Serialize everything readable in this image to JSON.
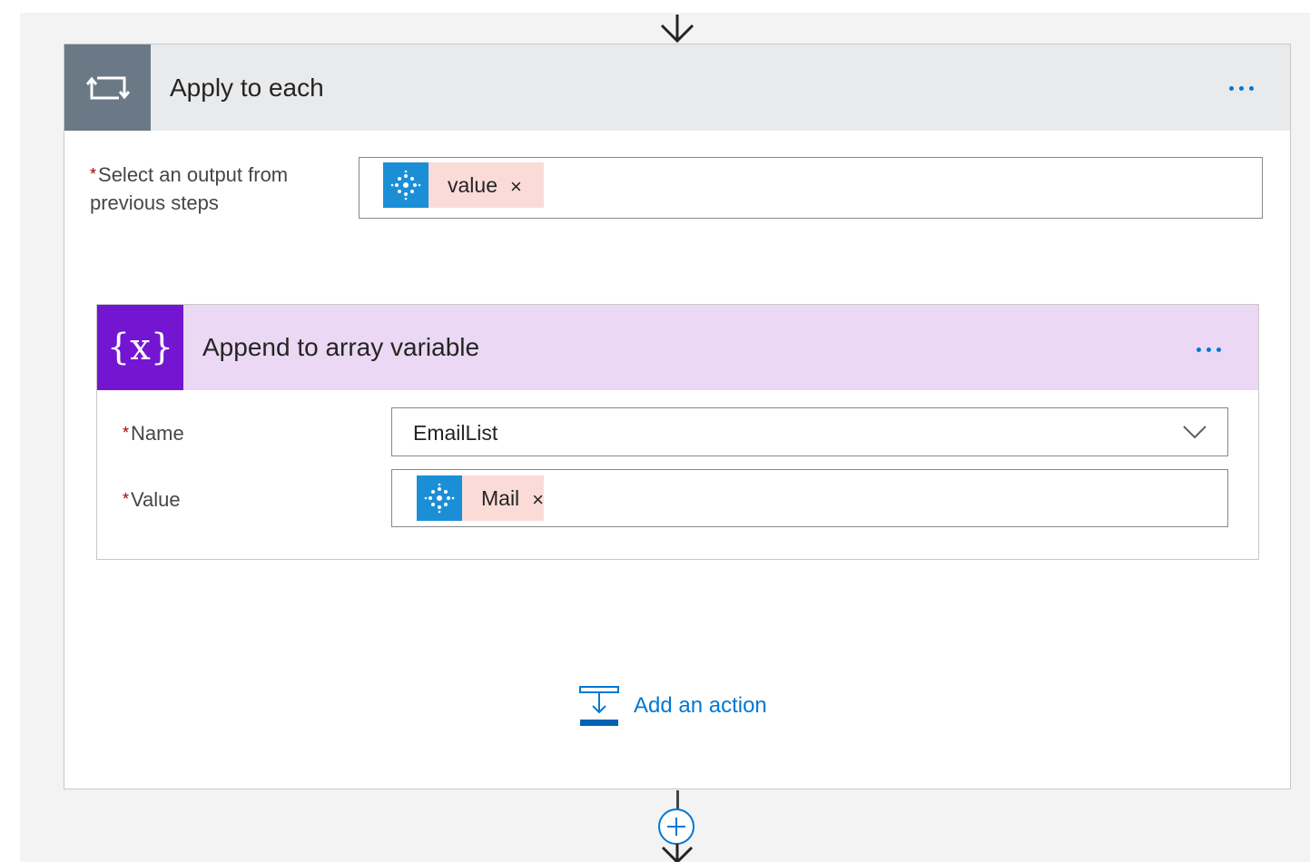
{
  "loop": {
    "title": "Apply to each",
    "field_label": "Select an output from previous steps",
    "token_label": "value",
    "remove_symbol": "×"
  },
  "action": {
    "title": "Append to array variable",
    "icon_text": "{x}",
    "name_label": "Name",
    "name_value": "EmailList",
    "value_label": "Value",
    "value_token": "Mail",
    "remove_symbol": "×"
  },
  "add_action": {
    "label": "Add an action"
  },
  "required_marker": "*",
  "icons": {
    "flow_arrow": "down-arrow-icon",
    "loop": "loop-icon",
    "token": "cognitive-service-icon",
    "variable": "variable-icon",
    "more": "ellipsis-icon",
    "dropdown": "chevron-down-icon",
    "add_action": "add-action-icon",
    "insert_step": "plus-circle-icon"
  },
  "colors": {
    "accent": "#0078d4",
    "loop_icon_bg": "#6b7885",
    "loop_header_bg": "#e8eaec",
    "variable_icon_bg": "#7416d1",
    "variable_header_bg": "#ead8f4",
    "token_bg": "#fadbd8",
    "token_icon_bg": "#1b8fd6",
    "required": "#a80000"
  }
}
